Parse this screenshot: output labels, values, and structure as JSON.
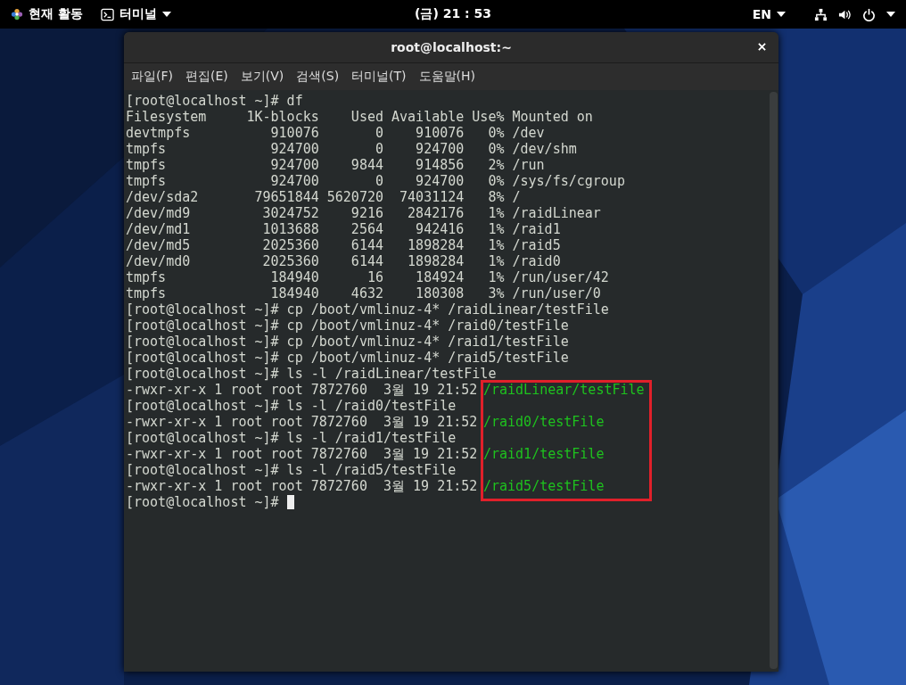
{
  "top_bar": {
    "activities": "현재 활동",
    "app_menu": "터미널",
    "clock": "(금) 21 : 53",
    "language": "EN"
  },
  "window": {
    "title": "root@localhost:~"
  },
  "menu": [
    "파일(F)",
    "편집(E)",
    "보기(V)",
    "검색(S)",
    "터미널(T)",
    "도움말(H)"
  ],
  "terminal_lines": [
    {
      "text": "[root@localhost ~]# df"
    },
    {
      "text": "Filesystem     1K-blocks    Used Available Use% Mounted on"
    },
    {
      "text": "devtmpfs          910076       0    910076   0% /dev"
    },
    {
      "text": "tmpfs             924700       0    924700   0% /dev/shm"
    },
    {
      "text": "tmpfs             924700    9844    914856   2% /run"
    },
    {
      "text": "tmpfs             924700       0    924700   0% /sys/fs/cgroup"
    },
    {
      "text": "/dev/sda2       79651844 5620720  74031124   8% /"
    },
    {
      "text": "/dev/md9         3024752    9216   2842176   1% /raidLinear"
    },
    {
      "text": "/dev/md1         1013688    2564    942416   1% /raid1"
    },
    {
      "text": "/dev/md5         2025360    6144   1898284   1% /raid5"
    },
    {
      "text": "/dev/md0         2025360    6144   1898284   1% /raid0"
    },
    {
      "text": "tmpfs             184940      16    184924   1% /run/user/42"
    },
    {
      "text": "tmpfs             184940    4632    180308   3% /run/user/0"
    },
    {
      "text": "[root@localhost ~]# cp /boot/vmlinuz-4* /raidLinear/testFile"
    },
    {
      "text": "[root@localhost ~]# cp /boot/vmlinuz-4* /raid0/testFile"
    },
    {
      "text": "[root@localhost ~]# cp /boot/vmlinuz-4* /raid1/testFile"
    },
    {
      "text": "[root@localhost ~]# cp /boot/vmlinuz-4* /raid5/testFile"
    },
    {
      "text": "[root@localhost ~]# ls -l /raidLinear/testFile"
    },
    {
      "text": "-rwxr-xr-x 1 root root 7872760  3월 19 21:52",
      "file": "/raidLinear/testFile"
    },
    {
      "text": "[root@localhost ~]# ls -l /raid0/testFile"
    },
    {
      "text": "-rwxr-xr-x 1 root root 7872760  3월 19 21:52",
      "file": "/raid0/testFile"
    },
    {
      "text": "[root@localhost ~]# ls -l /raid1/testFile"
    },
    {
      "text": "-rwxr-xr-x 1 root root 7872760  3월 19 21:52",
      "file": "/raid1/testFile"
    },
    {
      "text": "[root@localhost ~]# ls -l /raid5/testFile"
    },
    {
      "text": "-rwxr-xr-x 1 root root 7872760  3월 19 21:52",
      "file": "/raid5/testFile"
    },
    {
      "text": "[root@localhost ~]#",
      "cursor": true
    }
  ]
}
